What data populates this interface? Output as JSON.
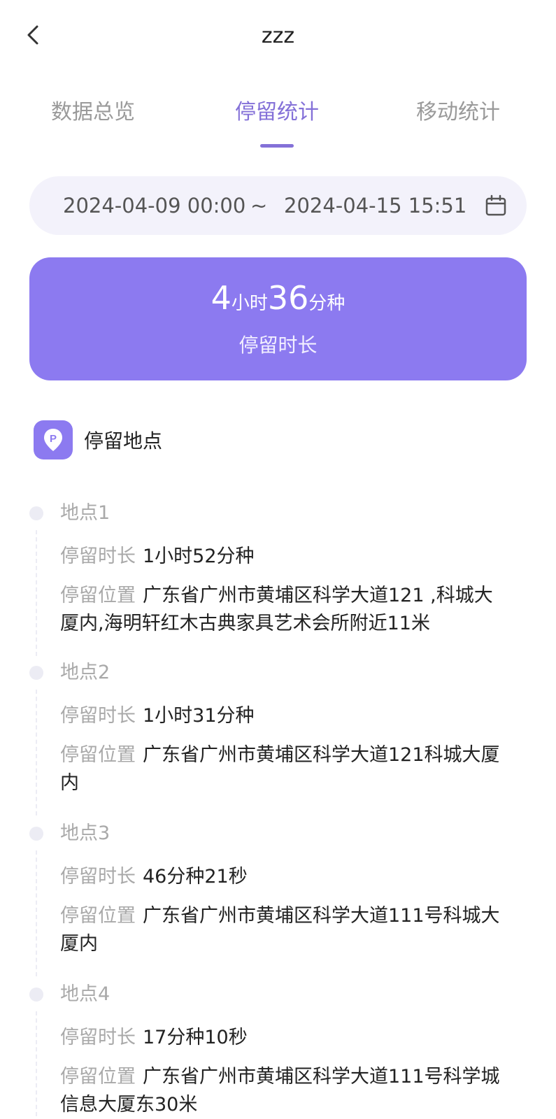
{
  "header": {
    "title": "zzz"
  },
  "tabs": [
    {
      "label": "数据总览"
    },
    {
      "label": "停留统计"
    },
    {
      "label": "移动统计"
    }
  ],
  "date_range": {
    "start": "2024-04-09 00:00",
    "separator": "~",
    "end": "2024-04-15 15:51"
  },
  "summary": {
    "hours": "4",
    "hours_unit": "小时",
    "minutes": "36",
    "minutes_unit": "分种",
    "label": "停留时长"
  },
  "section": {
    "icon_letter": "P",
    "title": "停留地点"
  },
  "stop_duration_label": "停留时长",
  "stop_location_label": "停留位置",
  "stops": [
    {
      "name": "地点1",
      "duration": "1小时52分种",
      "location": "广东省广州市黄埔区科学大道121 ,科城大厦内,海明轩红木古典家具艺术会所附近11米"
    },
    {
      "name": "地点2",
      "duration": "1小时31分种",
      "location": "广东省广州市黄埔区科学大道121科城大厦内"
    },
    {
      "name": "地点3",
      "duration": "46分种21秒",
      "location": "广东省广州市黄埔区科学大道111号科城大厦内"
    },
    {
      "name": "地点4",
      "duration": "17分种10秒",
      "location": "广东省广州市黄埔区科学大道111号科学城信息大厦东30米"
    }
  ],
  "colors": {
    "accent": "#8c7af0",
    "accent_text": "#8471d8",
    "date_bg": "#f3f2fb"
  }
}
